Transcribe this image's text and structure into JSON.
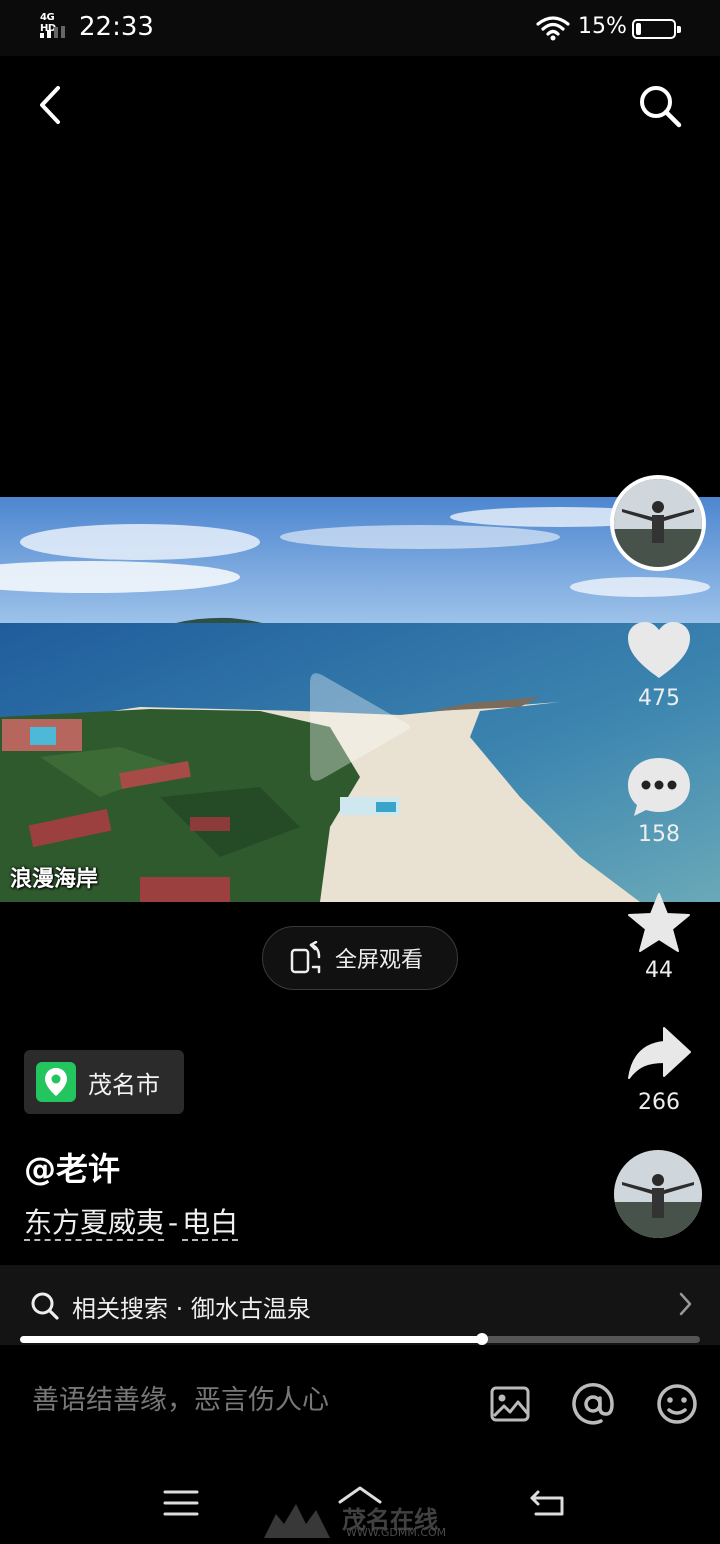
{
  "status_bar": {
    "network": "4G HD",
    "time": "22:33",
    "battery_percent_label": "15%",
    "battery_level": 0.15
  },
  "top_bar": {
    "back_icon": "chevron-left-icon",
    "search_icon": "search-icon"
  },
  "video": {
    "caption": "浪漫海岸",
    "progress": 0.68
  },
  "rail": {
    "likes": "475",
    "comments": "158",
    "favorites": "44",
    "shares": "266"
  },
  "fullscreen_label": "全屏观看",
  "location": "茂名市",
  "author": "@老许",
  "description": {
    "tag1": "东方夏威夷",
    "separator": "-",
    "tag2": "电白"
  },
  "related_search": {
    "label": "相关搜索 · 御水古温泉"
  },
  "comment": {
    "placeholder": "善语结善缘，恶言伤人心"
  },
  "watermark": {
    "text": "茂名在线",
    "url": "WWW.GDMM.COM"
  },
  "colors": {
    "background": "#000000",
    "location_pin": "#22c55e"
  }
}
